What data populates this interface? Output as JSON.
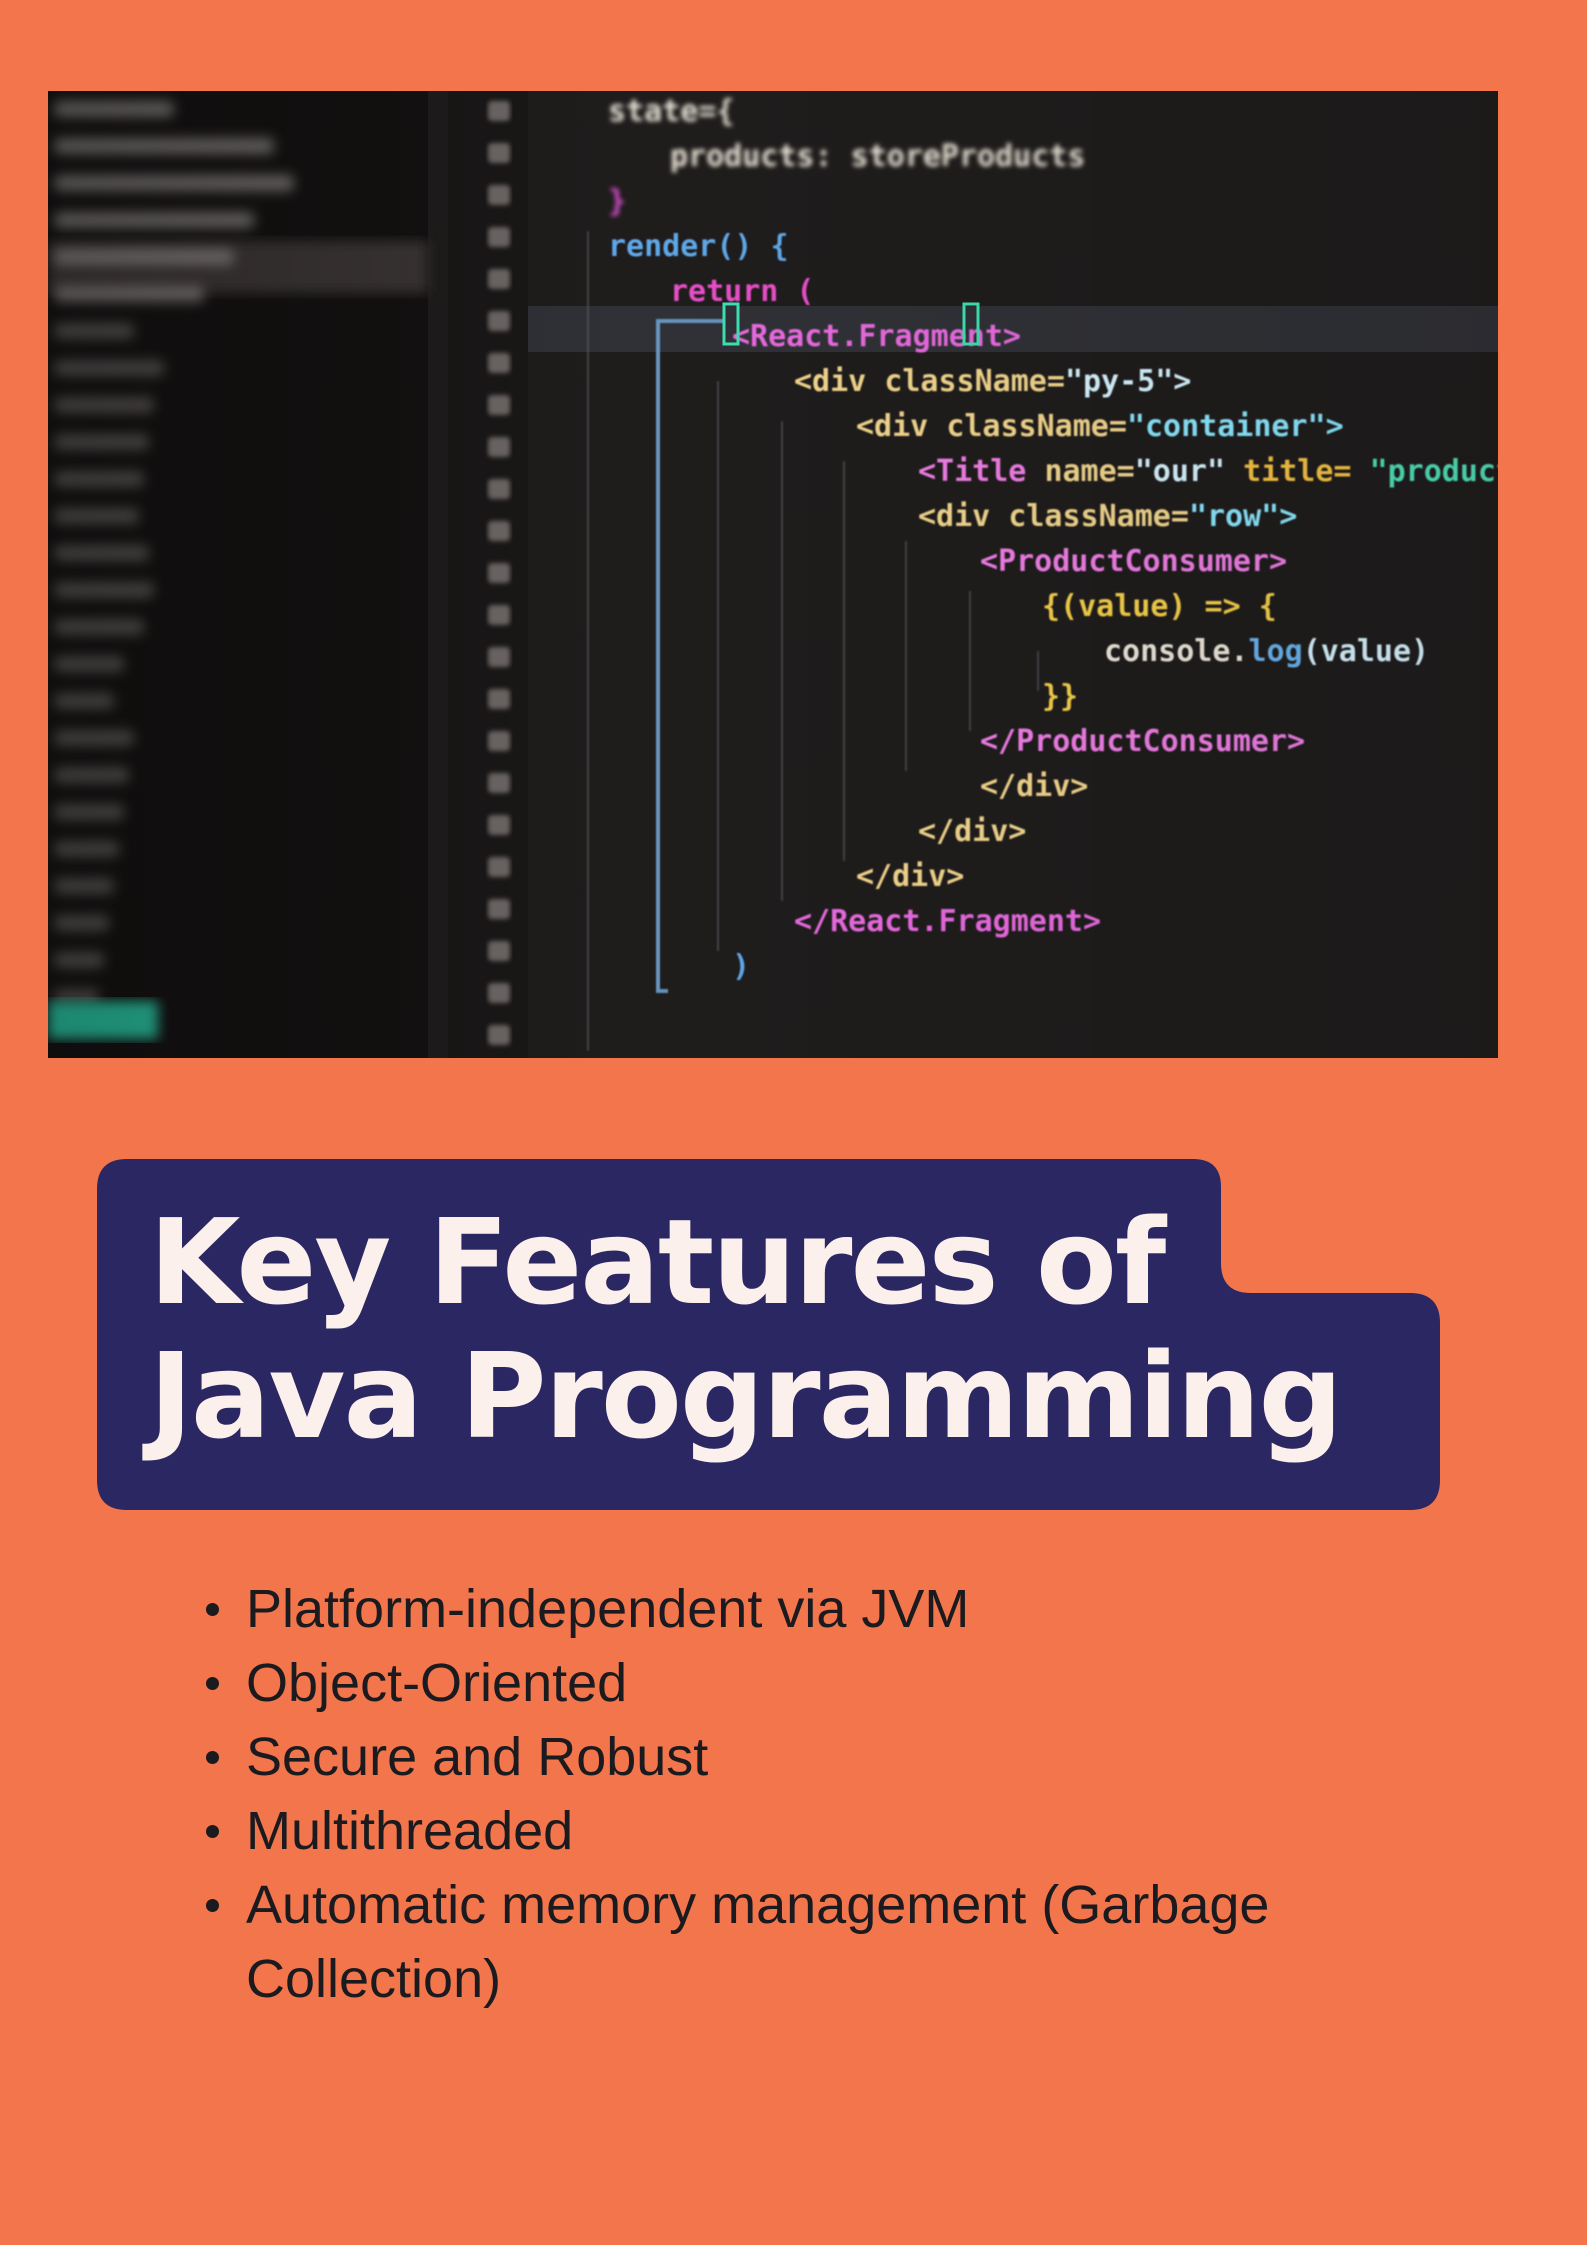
{
  "hero_image": {
    "icon": "code-editor-photo",
    "code_lines": [
      {
        "indent": 0,
        "parts": [
          [
            "state={",
            "#e8e4d8"
          ]
        ]
      },
      {
        "indent": 1,
        "parts": [
          [
            "products: storeProducts",
            "#ede7da"
          ]
        ]
      },
      {
        "indent": 0,
        "parts": [
          [
            "}",
            "#d84fd0"
          ]
        ]
      },
      {
        "indent": 0,
        "parts": [
          [
            "render() {",
            "#5fa8e8"
          ]
        ]
      },
      {
        "indent": 1,
        "parts": [
          [
            "return (",
            "#e850c8"
          ]
        ]
      },
      {
        "indent": 2,
        "parts": [
          [
            "<React.Fragment>",
            "#e86ae0"
          ]
        ]
      },
      {
        "indent": 3,
        "parts": [
          [
            "<div ",
            "#f2d68c"
          ],
          [
            "className=",
            "#f2d68c"
          ],
          [
            "\"py-5\">",
            "#d6f4ff"
          ]
        ]
      },
      {
        "indent": 4,
        "parts": [
          [
            "<div ",
            "#f2d68c"
          ],
          [
            "className=",
            "#f2d68c"
          ],
          [
            "\"container\">",
            "#8ae8ff"
          ]
        ]
      },
      {
        "indent": 5,
        "parts": [
          [
            "<Title ",
            "#f07ee6"
          ],
          [
            "name=",
            "#f2d68c"
          ],
          [
            "\"our\" ",
            "#d6f4ff"
          ],
          [
            "title= ",
            "#f5c242"
          ],
          [
            "\"product",
            "#4fe0b8"
          ]
        ]
      },
      {
        "indent": 5,
        "parts": [
          [
            "<div ",
            "#f2d68c"
          ],
          [
            "className=",
            "#f2d68c"
          ],
          [
            "\"row\">",
            "#8ae8ff"
          ]
        ]
      },
      {
        "indent": 6,
        "parts": [
          [
            "<ProductConsumer>",
            "#f07ee6"
          ]
        ]
      },
      {
        "indent": 7,
        "parts": [
          [
            "{(value) => {",
            "#f5d04a"
          ]
        ]
      },
      {
        "indent": 8,
        "parts": [
          [
            "console.",
            "#ece6da"
          ],
          [
            "log",
            "#6ab4f0"
          ],
          [
            "(value)",
            "#d6f4ff"
          ]
        ]
      },
      {
        "indent": 7,
        "parts": [
          [
            "}}",
            "#f5d04a"
          ]
        ]
      },
      {
        "indent": 6,
        "parts": [
          [
            "</ProductConsumer>",
            "#f07ee6"
          ]
        ]
      },
      {
        "indent": 6,
        "parts": [
          [
            "</div>",
            "#f2d68c"
          ]
        ]
      },
      {
        "indent": 5,
        "parts": [
          [
            "</div>",
            "#f2d68c"
          ]
        ]
      },
      {
        "indent": 4,
        "parts": [
          [
            "</div>",
            "#f2d68c"
          ]
        ]
      },
      {
        "indent": 3,
        "parts": [
          [
            "</React.Fragment>",
            "#e86ae0"
          ]
        ]
      },
      {
        "indent": 2,
        "parts": [
          [
            ")",
            "#5fa8e8"
          ]
        ]
      }
    ]
  },
  "title": {
    "line1": "Key Features of",
    "line2": "Java Programming"
  },
  "features": [
    "Platform-independent via JVM",
    "Object-Oriented",
    "Secure and Robust",
    "Multithreaded",
    "Automatic memory management (Garbage Collection)"
  ],
  "colors": {
    "background": "#f2754b",
    "title_block": "#2b2762",
    "title_text": "#fbf0ec",
    "body_text": "#1b1a1e"
  }
}
